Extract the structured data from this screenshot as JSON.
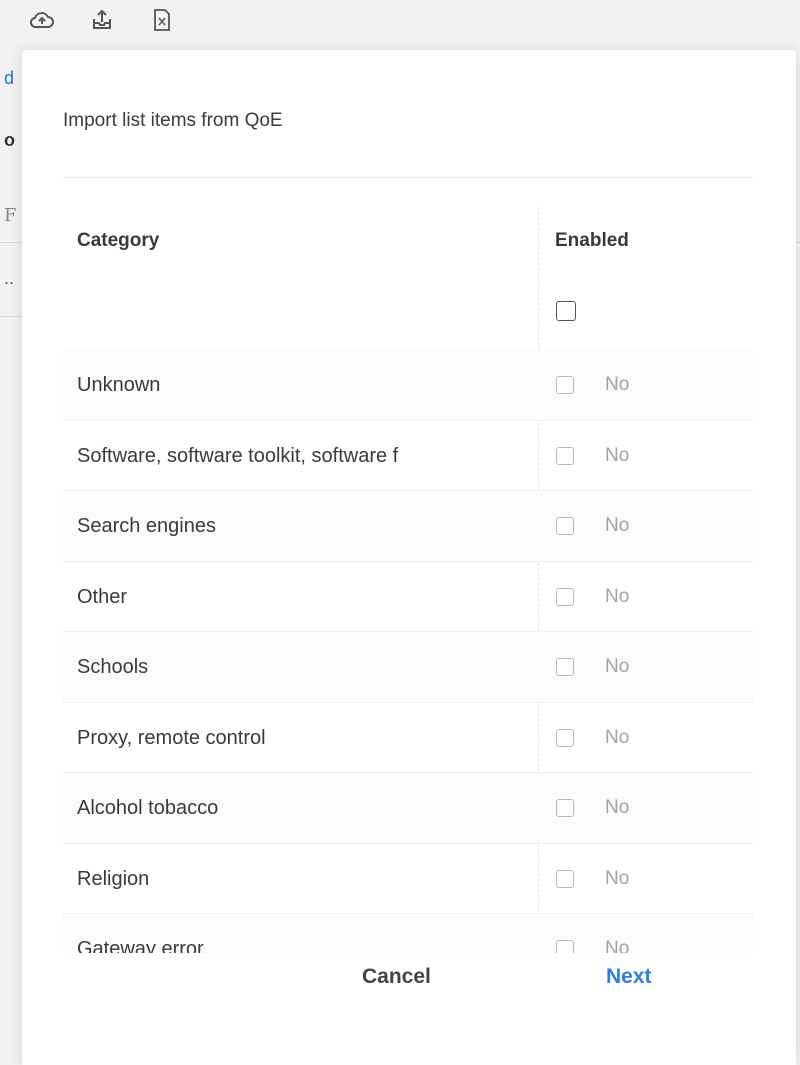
{
  "background": {
    "fragments": [
      "d",
      "o",
      "F",
      ".."
    ]
  },
  "modal": {
    "title": "Import list items from QoE",
    "columns": {
      "category": "Category",
      "enabled": "Enabled"
    },
    "rows": [
      {
        "category": "Unknown",
        "state": "No"
      },
      {
        "category": "Software, software toolkit, software f",
        "state": "No"
      },
      {
        "category": "Search engines",
        "state": "No"
      },
      {
        "category": "Other",
        "state": "No"
      },
      {
        "category": "Schools",
        "state": "No"
      },
      {
        "category": "Proxy, remote control",
        "state": "No"
      },
      {
        "category": "Alcohol tobacco",
        "state": "No"
      },
      {
        "category": "Religion",
        "state": "No"
      },
      {
        "category": "Gateway error",
        "state": "No"
      }
    ],
    "cancel_label": "Cancel",
    "next_label": "Next"
  },
  "colors": {
    "accent": "#2f7de1",
    "text": "#3a3a3a",
    "muted": "#a3a3a3"
  },
  "icons": [
    "cloud-upload-icon",
    "upload-tray-icon",
    "excel-file-icon"
  ]
}
